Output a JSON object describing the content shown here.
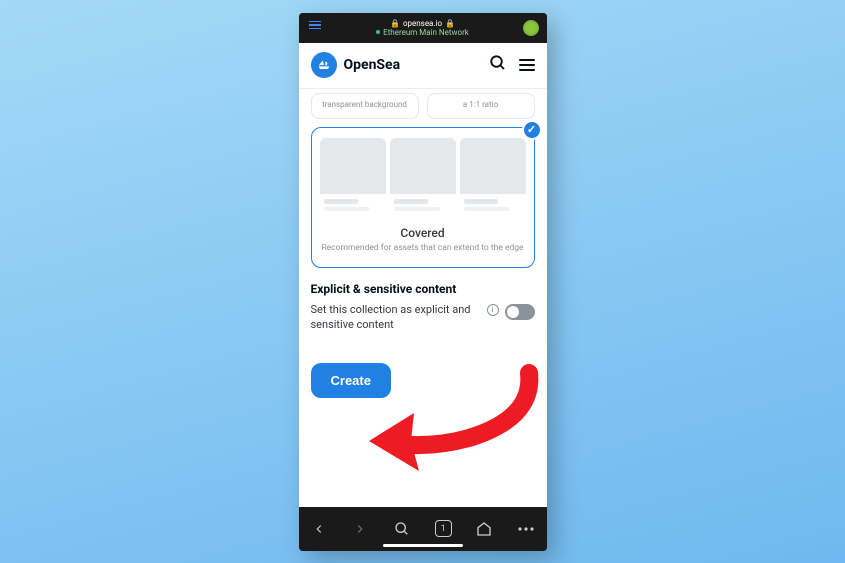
{
  "browser": {
    "url": "opensea.io",
    "network": "Ethereum Main Network"
  },
  "header": {
    "brand": "OpenSea"
  },
  "options": {
    "card1": "transparent background",
    "card2": "a 1:1 ratio"
  },
  "covered": {
    "title": "Covered",
    "description": "Recommended for assets that can extend to the edge"
  },
  "explicit": {
    "heading": "Explicit & sensitive content",
    "label": "Set this collection as explicit and sensitive content",
    "enabled": false
  },
  "actions": {
    "create": "Create"
  },
  "bottomBar": {
    "tabs": "1"
  },
  "colors": {
    "primary": "#2081e2",
    "arrow": "#ed1c24"
  }
}
